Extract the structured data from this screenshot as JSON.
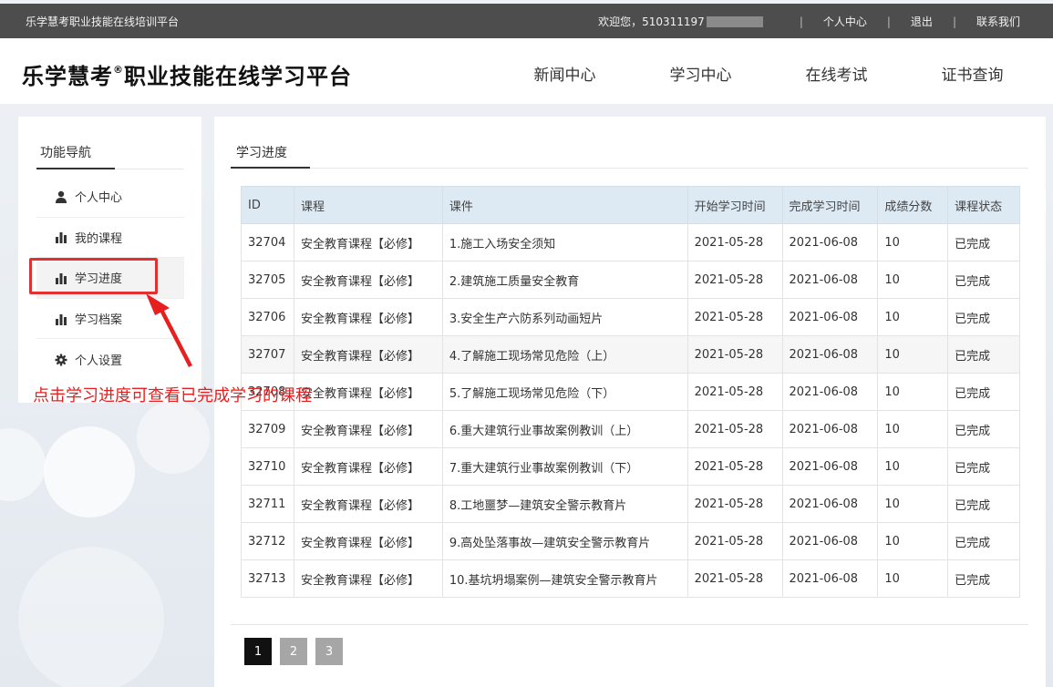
{
  "topbar": {
    "site_name": "乐学慧考职业技能在线培训平台",
    "welcome": "欢迎您，510311197",
    "links": [
      "个人中心",
      "退出",
      "联系我们"
    ],
    "separator": "|"
  },
  "header": {
    "logo_main": "乐学慧考",
    "logo_reg": "®",
    "logo_sub": "职业技能在线学习平台",
    "nav": [
      "新闻中心",
      "学习中心",
      "在线考试",
      "证书查询"
    ]
  },
  "sidebar": {
    "title": "功能导航",
    "items": [
      {
        "label": "个人中心",
        "icon": "user-icon"
      },
      {
        "label": "我的课程",
        "icon": "bar-chart-icon"
      },
      {
        "label": "学习进度",
        "icon": "bar-chart-icon"
      },
      {
        "label": "学习档案",
        "icon": "bar-chart-icon"
      },
      {
        "label": "个人设置",
        "icon": "gear-icon"
      }
    ],
    "active_index": 2
  },
  "content": {
    "title": "学习进度",
    "table": {
      "headers": [
        "ID",
        "课程",
        "课件",
        "开始学习时间",
        "完成学习时间",
        "成绩分数",
        "课程状态"
      ],
      "rows": [
        [
          "32704",
          "安全教育课程【必修】",
          "1.施工入场安全须知",
          "2021-05-28",
          "2021-06-08",
          "10",
          "已完成"
        ],
        [
          "32705",
          "安全教育课程【必修】",
          "2.建筑施工质量安全教育",
          "2021-05-28",
          "2021-06-08",
          "10",
          "已完成"
        ],
        [
          "32706",
          "安全教育课程【必修】",
          "3.安全生产六防系列动画短片",
          "2021-05-28",
          "2021-06-08",
          "10",
          "已完成"
        ],
        [
          "32707",
          "安全教育课程【必修】",
          "4.了解施工现场常见危险（上）",
          "2021-05-28",
          "2021-06-08",
          "10",
          "已完成"
        ],
        [
          "32708",
          "安全教育课程【必修】",
          "5.了解施工现场常见危险（下）",
          "2021-05-28",
          "2021-06-08",
          "10",
          "已完成"
        ],
        [
          "32709",
          "安全教育课程【必修】",
          "6.重大建筑行业事故案例教训（上）",
          "2021-05-28",
          "2021-06-08",
          "10",
          "已完成"
        ],
        [
          "32710",
          "安全教育课程【必修】",
          "7.重大建筑行业事故案例教训（下）",
          "2021-05-28",
          "2021-06-08",
          "10",
          "已完成"
        ],
        [
          "32711",
          "安全教育课程【必修】",
          "8.工地噩梦—建筑安全警示教育片",
          "2021-05-28",
          "2021-06-08",
          "10",
          "已完成"
        ],
        [
          "32712",
          "安全教育课程【必修】",
          "9.高处坠落事故—建筑安全警示教育片",
          "2021-05-28",
          "2021-06-08",
          "10",
          "已完成"
        ],
        [
          "32713",
          "安全教育课程【必修】",
          "10.基坑坍塌案例—建筑安全警示教育片",
          "2021-05-28",
          "2021-06-08",
          "10",
          "已完成"
        ]
      ]
    },
    "pagination": [
      "1",
      "2",
      "3"
    ],
    "current_page": "1"
  },
  "annotation": {
    "text": "点击学习进度可查看已完成学习的课程",
    "color": "#e62020"
  }
}
